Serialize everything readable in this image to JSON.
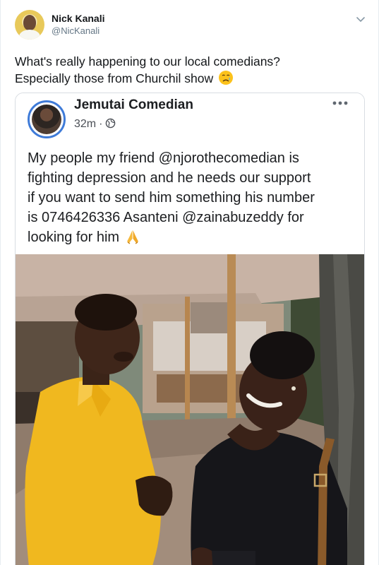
{
  "tweet": {
    "author_name": "Nick Kanali",
    "author_handle": "@NicKanali",
    "text_line1": "What's really happening to our local comedians?",
    "text_line2": "Especially those from Churchil show"
  },
  "embed": {
    "page_name": "Jemutai Comedian",
    "time_ago": "32m",
    "separator": "·",
    "post_line1": "My people my friend @njorothecomedian is",
    "post_line2": "fighting depression and he needs our support",
    "post_line3": "if you want to send him something his number",
    "post_line4": "is 0746426336 Asanteni @zainabuzeddy for",
    "post_line5": "looking for him"
  },
  "icons": {
    "caret": "chevron-down-icon",
    "cry": "crying-face-emoji",
    "globe": "globe-icon",
    "more": "more-options-icon",
    "pray": "folded-hands-emoji"
  },
  "colors": {
    "handle_gray": "#657786",
    "fb_avatar_ring": "#3f7bd8",
    "yellow_shirt": "#f0b81f"
  }
}
